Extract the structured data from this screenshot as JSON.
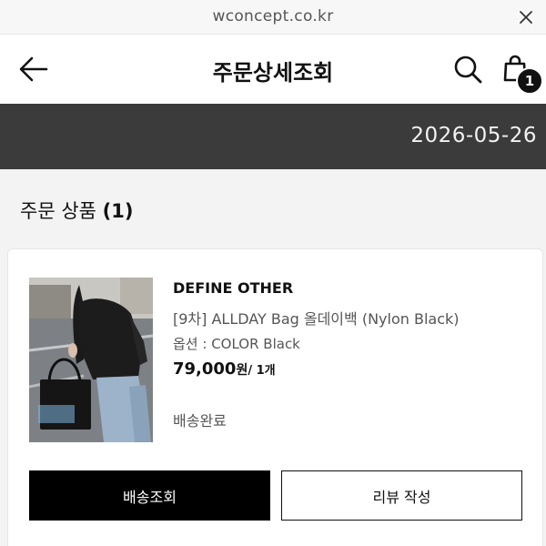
{
  "browser": {
    "url": "wconcept.co.kr",
    "close_icon": "close-icon"
  },
  "header": {
    "title": "주문상세조회",
    "back_icon": "arrow-left-icon",
    "search_icon": "search-icon",
    "cart_icon": "shopping-bag-icon",
    "cart_count": "1"
  },
  "order": {
    "date": "2026-05-26"
  },
  "items_section": {
    "label": "주문 상품",
    "count": "(1)"
  },
  "product": {
    "brand": "DEFINE OTHER",
    "name": "[9차] ALLDAY Bag 올데이백 (Nylon Black)",
    "option": "옵션 : COLOR Black",
    "price": "79,000",
    "currency": "원",
    "quantity": "/ 1개",
    "status": "배송완료"
  },
  "actions": {
    "track": "배송조회",
    "review": "리뷰 작성"
  },
  "colors": {
    "date_band": "#3b3b3b",
    "primary_button": "#000000",
    "badge": "#111111"
  }
}
